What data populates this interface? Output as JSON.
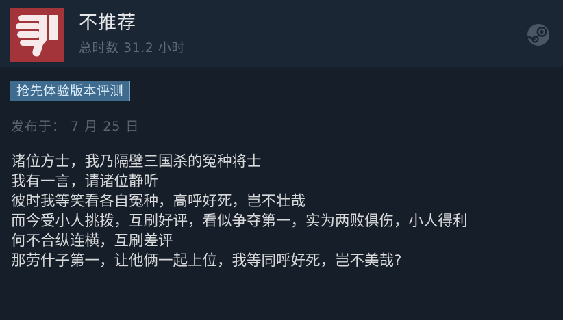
{
  "review": {
    "verdict": "不推荐",
    "playtime": "总时数 31.2 小时",
    "badge": "抢先体验版本评测",
    "posted": "发布于： 7 月 25 日",
    "lines": [
      "诸位方士，我乃隔壁三国杀的冤种将士",
      "我有一言，请诸位静听",
      "彼时我等笑看各自冤种，高呼好死，岂不壮哉",
      "而今受小人挑拨，互刷好评，看似争夺第一，实为两败俱伤，小人得利",
      "何不合纵连横，互刷差评",
      "那劳什子第一，让他俩一起上位，我等同呼好死，岂不美哉?"
    ]
  },
  "icons": {
    "verdict_icon": "thumbs-down-icon",
    "platform_icon": "steam-icon"
  },
  "colors": {
    "background": "#161e29",
    "header": "#1b2634",
    "thumb_background": "#a3353a",
    "badge_background": "#3f6b8f",
    "badge_border": "#7fa8c9"
  }
}
